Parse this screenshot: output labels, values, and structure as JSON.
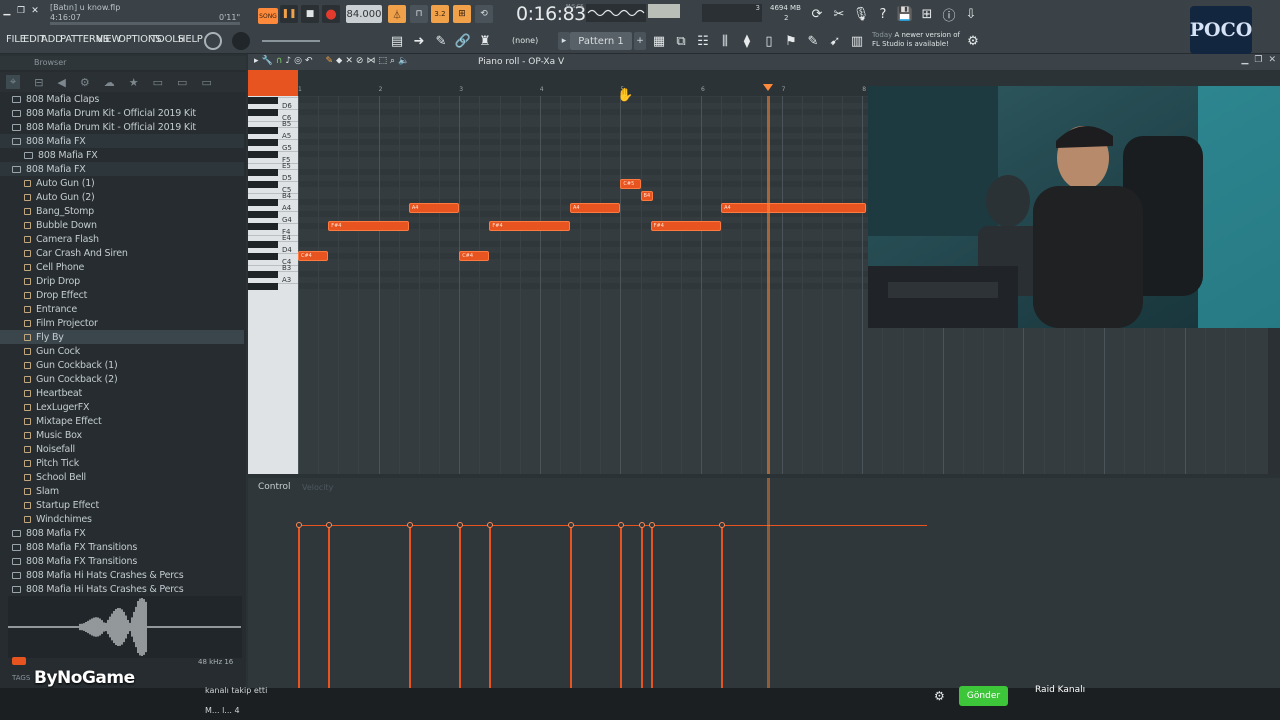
{
  "title": {
    "file": "[Batın] u know.flp",
    "time": "4:16:07",
    "small_time": "0'11\""
  },
  "transport": {
    "song_label": "SONG",
    "tempo": "84.000",
    "time_display": "0:16:83",
    "ms_label": "M:S:CS",
    "mem": "4694 MB",
    "cpu_a": "3",
    "cpu_b": "2"
  },
  "menu": [
    "FILE",
    "EDIT",
    "ADD",
    "PATTERNS",
    "VIEW",
    "OPTIONS",
    "TOOLS",
    "HELP"
  ],
  "toolbar2": {
    "none_label": "(none)",
    "pattern_label": "Pattern 1",
    "news_today": "Today",
    "news_text": "A newer version of FL Studio is available!"
  },
  "browser": {
    "header": "Browser",
    "items": [
      {
        "label": "808 Mafia Claps",
        "type": "folder",
        "indent": 0
      },
      {
        "label": "808 Mafia Drum Kit - Official 2019 Kit",
        "type": "folder",
        "indent": 0
      },
      {
        "label": "808 Mafia Drum Kit - Official 2019 Kit",
        "type": "folder",
        "indent": 0
      },
      {
        "label": "808 Mafia FX",
        "type": "folder",
        "indent": 0,
        "highlight": true
      },
      {
        "label": "808 Mafia FX",
        "type": "folder",
        "indent": 1
      },
      {
        "label": "808 Mafia FX",
        "type": "folder",
        "indent": 0,
        "highlight": true
      },
      {
        "label": "Auto Gun (1)",
        "type": "file",
        "indent": 1
      },
      {
        "label": "Auto Gun (2)",
        "type": "file",
        "indent": 1
      },
      {
        "label": "Bang_Stomp",
        "type": "file",
        "indent": 1
      },
      {
        "label": "Bubble Down",
        "type": "file",
        "indent": 1
      },
      {
        "label": "Camera Flash",
        "type": "file",
        "indent": 1
      },
      {
        "label": "Car Crash And Siren",
        "type": "file",
        "indent": 1
      },
      {
        "label": "Cell Phone",
        "type": "file",
        "indent": 1
      },
      {
        "label": "Drip Drop",
        "type": "file",
        "indent": 1
      },
      {
        "label": "Drop Effect",
        "type": "file",
        "indent": 1
      },
      {
        "label": "Entrance",
        "type": "file",
        "indent": 1
      },
      {
        "label": "Film Projector",
        "type": "file",
        "indent": 1
      },
      {
        "label": "Fly By",
        "type": "file",
        "indent": 1,
        "selected": true
      },
      {
        "label": "Gun Cock",
        "type": "file",
        "indent": 1
      },
      {
        "label": "Gun Cockback (1)",
        "type": "file",
        "indent": 1
      },
      {
        "label": "Gun Cockback (2)",
        "type": "file",
        "indent": 1
      },
      {
        "label": "Heartbeat",
        "type": "file",
        "indent": 1
      },
      {
        "label": "LexLugerFX",
        "type": "file",
        "indent": 1
      },
      {
        "label": "Mixtape Effect",
        "type": "file",
        "indent": 1
      },
      {
        "label": "Music Box",
        "type": "file",
        "indent": 1
      },
      {
        "label": "Noisefall",
        "type": "file",
        "indent": 1
      },
      {
        "label": "Pitch Tick",
        "type": "file",
        "indent": 1
      },
      {
        "label": "School Bell",
        "type": "file",
        "indent": 1
      },
      {
        "label": "Slam",
        "type": "file",
        "indent": 1
      },
      {
        "label": "Startup Effect",
        "type": "file",
        "indent": 1
      },
      {
        "label": "Windchimes",
        "type": "file",
        "indent": 1
      },
      {
        "label": "808 Mafia FX",
        "type": "folder",
        "indent": 0
      },
      {
        "label": "808 Mafia FX Transitions",
        "type": "folder",
        "indent": 0
      },
      {
        "label": "808 Mafia FX Transitions",
        "type": "folder",
        "indent": 0
      },
      {
        "label": "808 Mafia Hi Hats Crashes & Percs",
        "type": "folder",
        "indent": 0
      },
      {
        "label": "808 Mafia Hi Hats Crashes & Percs",
        "type": "folder",
        "indent": 0
      }
    ],
    "sample_rate": "48 kHz 16",
    "tags_label": "TAGS"
  },
  "piano_roll": {
    "title": "Piano roll - OP-Xa V",
    "bars": [
      "1",
      "2",
      "3",
      "4",
      "5",
      "6",
      "7",
      "8"
    ],
    "key_labels": [
      "D6",
      "C6",
      "B5",
      "A5",
      "G5",
      "F5",
      "E5",
      "D5",
      "C5",
      "B4",
      "A4",
      "G4",
      "F4",
      "E4",
      "D4",
      "C4",
      "B3",
      "A3"
    ],
    "notes": [
      {
        "label": "C#5",
        "bar_start": 5.0,
        "length": 0.25,
        "pitch": "C#5"
      },
      {
        "label": "B4",
        "bar_start": 5.25,
        "length": 0.15,
        "pitch": "B4"
      },
      {
        "label": "A4",
        "bar_start": 2.375,
        "length": 0.625,
        "pitch": "A4"
      },
      {
        "label": "A4",
        "bar_start": 4.375,
        "length": 0.625,
        "pitch": "A4"
      },
      {
        "label": "A4",
        "bar_start": 6.25,
        "length": 1.8,
        "pitch": "A4"
      },
      {
        "label": "F#4",
        "bar_start": 1.375,
        "length": 1.0,
        "pitch": "F#4"
      },
      {
        "label": "F#4",
        "bar_start": 3.375,
        "length": 1.0,
        "pitch": "F#4"
      },
      {
        "label": "F#4",
        "bar_start": 5.375,
        "length": 0.875,
        "pitch": "F#4"
      },
      {
        "label": "C#4",
        "bar_start": 1.0,
        "length": 0.375,
        "pitch": "C#4"
      },
      {
        "label": "C#4",
        "bar_start": 3.0,
        "length": 0.375,
        "pitch": "C#4"
      }
    ],
    "playhead_bar": 6.82,
    "control_label": "Control",
    "control_param": "Velocity",
    "velocity_events": [
      1.0,
      1.375,
      2.375,
      3.0,
      3.375,
      4.375,
      5.0,
      5.25,
      5.375,
      6.25
    ]
  },
  "overlay": {
    "watermark": "ByNoGame",
    "chat_text": "kanalı takip etti",
    "send_button": "Gönder",
    "raid_text": "Raid Kanalı",
    "user_text": "M... l... 4"
  },
  "logo": {
    "text": "POCO"
  },
  "colors": {
    "note": "#e8541f",
    "accent": "#ff8a3c",
    "send": "#3ec63a"
  }
}
